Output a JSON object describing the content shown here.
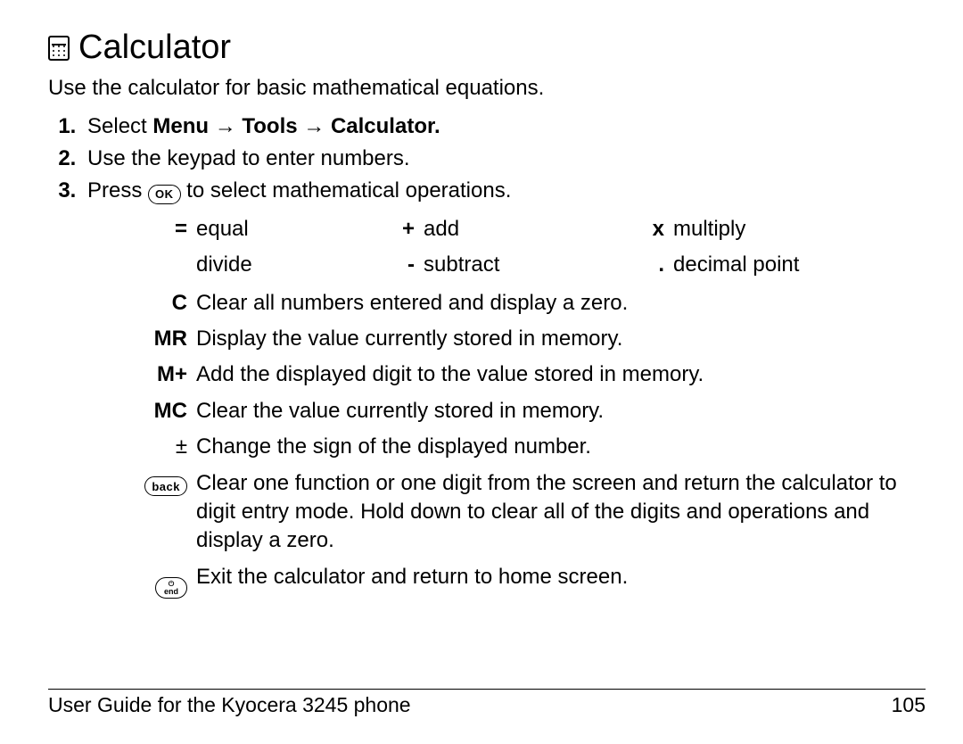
{
  "heading": "Calculator",
  "intro": "Use the calculator for basic mathematical equations.",
  "steps": {
    "s1_pre": "Select ",
    "s1_menu": "Menu",
    "s1_arrow": " → ",
    "s1_tools": "Tools",
    "s1_calc": "Calculator.",
    "s2": "Use the keypad to enter numbers.",
    "s3_pre": "Press ",
    "s3_key": "OK",
    "s3_post": " to select mathematical operations."
  },
  "ops": {
    "eq_sym": "=",
    "eq_label": "equal",
    "plus_sym": "+",
    "plus_label": "add",
    "x_sym": "x",
    "x_label": "multiply",
    "div_sym": "",
    "div_label": "divide",
    "minus_sym": "-",
    "minus_label": "subtract",
    "dot_sym": ".",
    "dot_label": "decimal point"
  },
  "defs": {
    "c_sym": "C",
    "c_desc": "Clear all numbers entered and display a zero.",
    "mr_sym": "MR",
    "mr_desc": "Display the value currently stored in memory.",
    "mplus_sym": "M+",
    "mplus_desc": "Add the displayed digit to the value stored in memory.",
    "mc_sym": "MC",
    "mc_desc": "Clear the value currently stored in memory.",
    "pm_sym": "±",
    "pm_desc": "Change the sign of the displayed number.",
    "back_key": "back",
    "back_desc": "Clear one function or one digit from the screen and return the calculator to digit entry mode. Hold down to clear all of the digits and operations and display a zero.",
    "end_top": "⏻",
    "end_key": "end",
    "end_desc": "Exit the calculator and return to home screen."
  },
  "footer": {
    "left": "User Guide for the Kyocera 3245 phone",
    "right": "105"
  }
}
